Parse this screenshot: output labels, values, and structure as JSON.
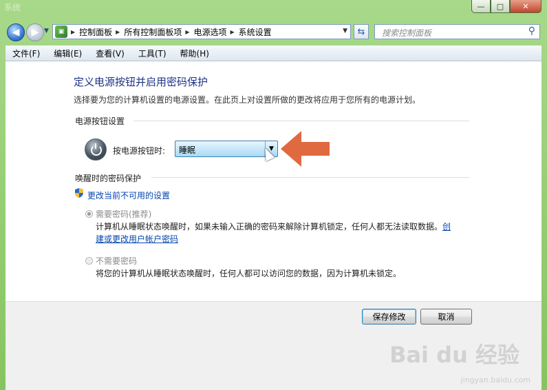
{
  "window": {
    "title": "系统",
    "controls": {
      "minimize": "—",
      "maximize": "□",
      "close": "✕"
    }
  },
  "nav": {
    "back_icon": "arrow-left-icon",
    "forward_icon": "arrow-right-icon",
    "breadcrumb": [
      "控制面板",
      "所有控制面板项",
      "电源选项",
      "系统设置"
    ],
    "search_placeholder": "搜索控制面板"
  },
  "menu": [
    "文件(F)",
    "编辑(E)",
    "查看(V)",
    "工具(T)",
    "帮助(H)"
  ],
  "page": {
    "heading": "定义电源按钮并启用密码保护",
    "description": "选择要为您的计算机设置的电源设置。在此页上对设置所做的更改将应用于您所有的电源计划。",
    "power_section": {
      "title": "电源按钮设置",
      "label": "按电源按钮时:",
      "selected": "睡眠"
    },
    "password_section": {
      "title": "唤醒时的密码保护",
      "change_link": "更改当前不可用的设置",
      "option_require": {
        "title": "需要密码(推荐)",
        "desc_line1": "计算机从睡眠状态唤醒时，如果未输入正确的密码来解除计算机锁定，任何人都无法读取数据。",
        "link_part1": "创",
        "link_part2": "建或更改用户帐户密码",
        "checked": true
      },
      "option_none": {
        "title": "不需要密码",
        "desc": "将您的计算机从睡眠状态唤醒时，任何人都可以访问您的数据，因为计算机未锁定。",
        "checked": false
      }
    }
  },
  "buttons": {
    "save": "保存修改",
    "cancel": "取消"
  },
  "watermark": {
    "main": "Bai du 经验",
    "sub": "jingyan.baidu.com"
  },
  "colors": {
    "heading": "#1e3287",
    "link": "#0645ad",
    "annotation_arrow": "#e0693f"
  }
}
